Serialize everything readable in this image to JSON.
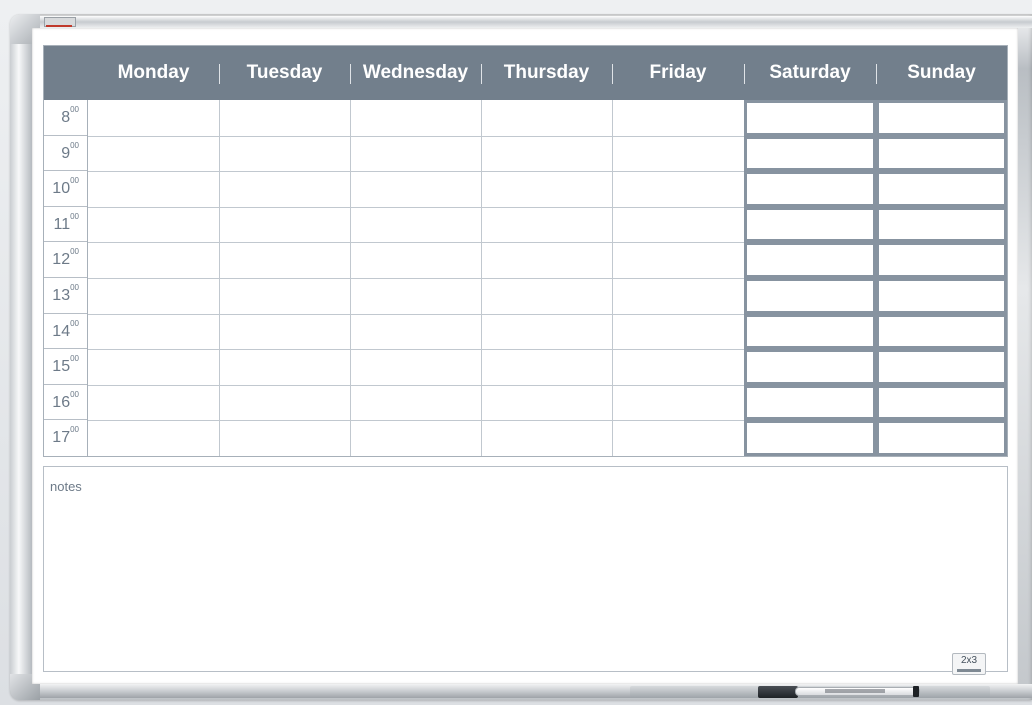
{
  "days": [
    "Monday",
    "Tuesday",
    "Wednesday",
    "Thursday",
    "Friday",
    "Saturday",
    "Sunday"
  ],
  "hours": [
    {
      "hour": "8",
      "min": "00"
    },
    {
      "hour": "9",
      "min": "00"
    },
    {
      "hour": "10",
      "min": "00"
    },
    {
      "hour": "11",
      "min": "00"
    },
    {
      "hour": "12",
      "min": "00"
    },
    {
      "hour": "13",
      "min": "00"
    },
    {
      "hour": "14",
      "min": "00"
    },
    {
      "hour": "15",
      "min": "00"
    },
    {
      "hour": "16",
      "min": "00"
    },
    {
      "hour": "17",
      "min": "00"
    }
  ],
  "notes": {
    "label": "notes"
  },
  "brand": {
    "logo_text": "2x3"
  },
  "colors": {
    "header_bg": "#727f8c",
    "header_text": "#ffffff",
    "time_text": "#6d7a88",
    "weekend_border": "#8793a0"
  }
}
